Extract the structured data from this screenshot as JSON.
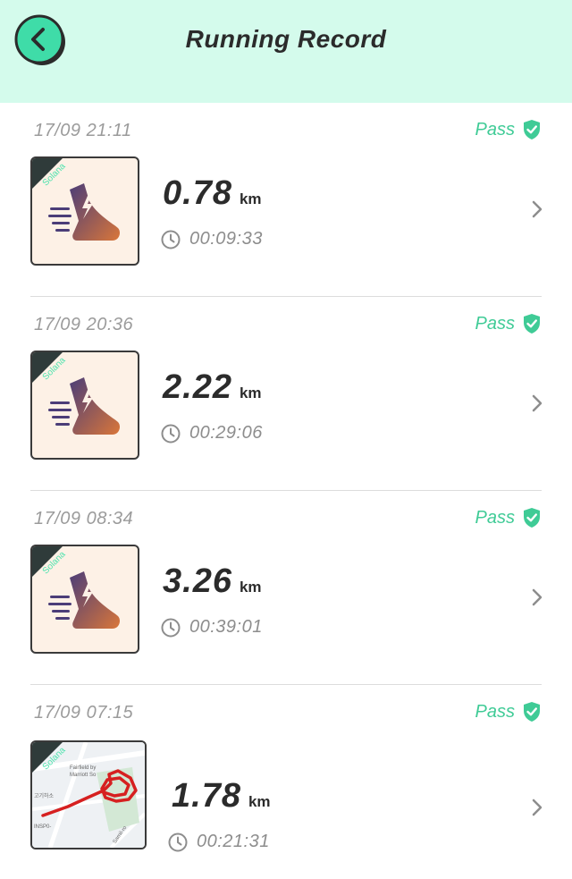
{
  "header": {
    "title": "Running Record"
  },
  "colors": {
    "accent": "#3fcb96",
    "header_bg": "#d4fbec"
  },
  "records": [
    {
      "datetime": "17/09 21:11",
      "status": "Pass",
      "distance": "0.78",
      "unit": "km",
      "duration": "00:09:33",
      "thumb_label": "Solana",
      "thumb": "shoe-icon"
    },
    {
      "datetime": "17/09 20:36",
      "status": "Pass",
      "distance": "2.22",
      "unit": "km",
      "duration": "00:29:06",
      "thumb_label": "Solana",
      "thumb": "shoe-icon"
    },
    {
      "datetime": "17/09 08:34",
      "status": "Pass",
      "distance": "3.26",
      "unit": "km",
      "duration": "00:39:01",
      "thumb_label": "Solana",
      "thumb": "shoe-icon"
    },
    {
      "datetime": "17/09 07:15",
      "status": "Pass",
      "distance": "1.78",
      "unit": "km",
      "duration": "00:21:31",
      "thumb_label": "Solana",
      "thumb": "route-map",
      "map_labels": [
        "Fairfield by",
        "Marriott So",
        "고기하소",
        "INSP0-",
        "Samil-ro"
      ]
    }
  ]
}
